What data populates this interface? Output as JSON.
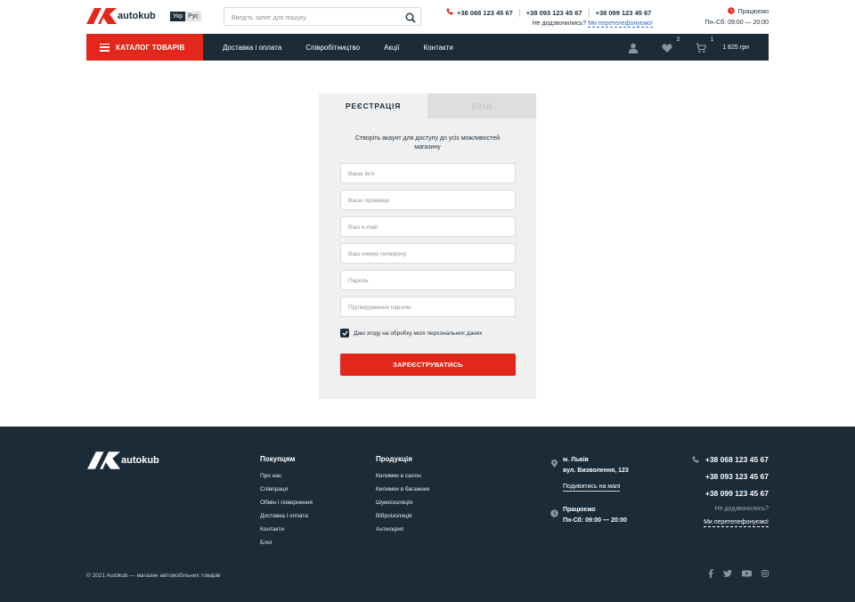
{
  "header": {
    "logo_text": "autokub",
    "languages": [
      "Укр",
      "Рус"
    ],
    "search_placeholder": "Введіть запит для пошуку",
    "phones": [
      "+38 068 123 45 67",
      "+38 093 123 45 67",
      "+38 099 123 45 67"
    ],
    "callback_question": "Не додзвонились?",
    "callback_link": "Ми перетелефонуємо!",
    "work_status": "Працюємо",
    "work_hours": "Пн–Сб: 09:00 — 20:00"
  },
  "nav": {
    "catalog_label": "КАТАЛОГ ТОВАРІВ",
    "links": [
      "Доставка і оплата",
      "Співробітництво",
      "Акції",
      "Контакти"
    ],
    "wishlist_count": "2",
    "cart_count": "1",
    "cart_sum": "1 825 грн"
  },
  "form": {
    "tab_register": "РЕЄСТРАЦІЯ",
    "tab_login": "ВХІД",
    "intro": "Створіть акаунт для доступу до усіх можливостей магазину",
    "fields": [
      "Ваше ім'я",
      "Ваше прізвище",
      "Ваш e-mail",
      "Ваш номер телефону",
      "Пароль",
      "Підтвердження паролю"
    ],
    "consent": "Даю згоду на обробку моїх персональних даних",
    "consent_checked": true,
    "submit": "ЗАРЕЄСТРУВАТИСЬ"
  },
  "footer": {
    "logo_text": "autokub",
    "col1_title": "Покупцям",
    "col1_items": [
      "Про нас",
      "Співпраця",
      "Обмін і повернення",
      "Доставка і оплата",
      "Контакти",
      "Блог"
    ],
    "col2_title": "Продукція",
    "col2_items": [
      "Килимки в салон",
      "Килимки в багажник",
      "Шумоізоляція",
      "Віброізоляція",
      "Антискрип"
    ],
    "city": "м. Львів",
    "street": "вул. Визволення, 123",
    "map_link": "Подивитись на мапі",
    "work_status": "Працюємо",
    "work_hours": "Пн-Сб: 09:00 — 20:00",
    "phones": [
      "+38 068 123 45 67",
      "+38 093 123 45 67",
      "+38 099 123 45 67"
    ],
    "callback_question": "Не додзвонились?",
    "callback_link": "Ми перетелефонуємо!",
    "copyright": "© 2021 Autokub — магазин автомобільних товарів",
    "social": [
      "facebook-icon",
      "twitter-icon",
      "youtube-icon",
      "instagram-icon"
    ]
  },
  "colors": {
    "accent": "#e3281b",
    "dark": "#1b2b38",
    "link": "#2f6bd3"
  }
}
